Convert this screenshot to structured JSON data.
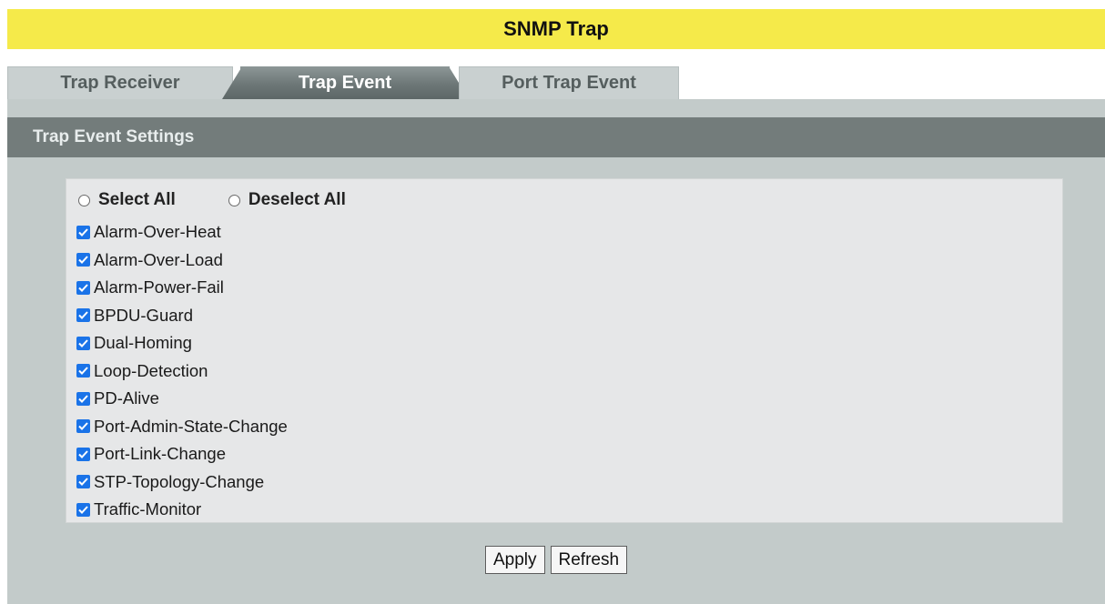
{
  "header": {
    "title": "SNMP Trap"
  },
  "tabs": [
    {
      "label": "Trap Receiver",
      "active": false
    },
    {
      "label": "Trap Event",
      "active": true
    },
    {
      "label": "Port Trap Event",
      "active": false
    }
  ],
  "section": {
    "title": "Trap Event Settings"
  },
  "selection": {
    "select_all": "Select All",
    "deselect_all": "Deselect All"
  },
  "events": [
    {
      "label": "Alarm-Over-Heat",
      "checked": true
    },
    {
      "label": "Alarm-Over-Load",
      "checked": true
    },
    {
      "label": "Alarm-Power-Fail",
      "checked": true
    },
    {
      "label": "BPDU-Guard",
      "checked": true
    },
    {
      "label": "Dual-Homing",
      "checked": true
    },
    {
      "label": "Loop-Detection",
      "checked": true
    },
    {
      "label": "PD-Alive",
      "checked": true
    },
    {
      "label": "Port-Admin-State-Change",
      "checked": true
    },
    {
      "label": "Port-Link-Change",
      "checked": true
    },
    {
      "label": "STP-Topology-Change",
      "checked": true
    },
    {
      "label": "Traffic-Monitor",
      "checked": true
    }
  ],
  "actions": {
    "apply_label": "Apply",
    "refresh_label": "Refresh"
  },
  "colors": {
    "title_bar": "#f5ea4a",
    "active_tab": "#6d7777",
    "section_header": "#737c7b",
    "panel": "#c3cbca",
    "checkbox": "#1a73e8"
  }
}
